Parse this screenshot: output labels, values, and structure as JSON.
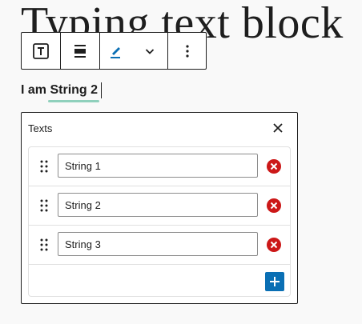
{
  "block": {
    "title": "Typing text block",
    "typed_prefix": "I am ",
    "typed_word": "String 2"
  },
  "toolbar": {
    "buttons": [
      {
        "name": "block-type-button",
        "icon": "text-block-icon"
      },
      {
        "name": "align-button",
        "icon": "align-center-icon"
      },
      {
        "name": "highlight-button",
        "icon": "pen-icon"
      },
      {
        "name": "more-rich-text-button",
        "icon": "chevron-down-icon"
      },
      {
        "name": "options-button",
        "icon": "more-vertical-icon"
      }
    ]
  },
  "popover": {
    "title": "Texts",
    "items": [
      {
        "value": "String 1"
      },
      {
        "value": "String 2"
      },
      {
        "value": "String 3"
      }
    ]
  },
  "colors": {
    "accent": "#0a6fb4",
    "remove": "#cc1818",
    "underline": "#8fd0bc",
    "pen": "#0a6fb4"
  }
}
